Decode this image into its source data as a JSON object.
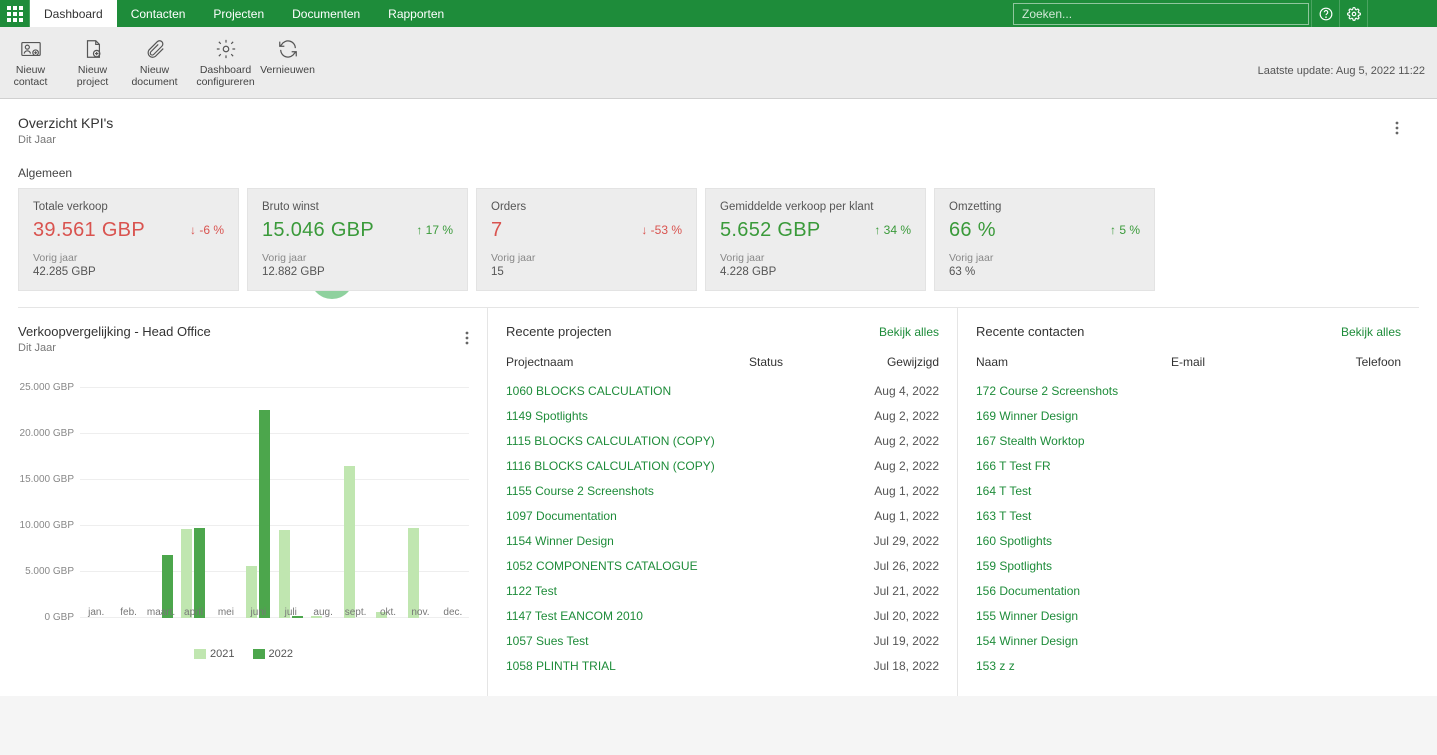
{
  "nav": {
    "items": [
      "Dashboard",
      "Contacten",
      "Projecten",
      "Documenten",
      "Rapporten"
    ],
    "active": 0,
    "search_placeholder": "Zoeken..."
  },
  "toolbar": {
    "items": [
      {
        "label": "Nieuw contact"
      },
      {
        "label": "Nieuw project"
      },
      {
        "label": "Nieuw document"
      },
      {
        "label": "Dashboard configureren"
      },
      {
        "label": "Vernieuwen"
      }
    ],
    "last_update_label": "Laatste update:",
    "last_update_value": "Aug 5, 2022 11:22"
  },
  "kpi_section": {
    "title": "Overzicht KPI's",
    "subtitle": "Dit Jaar",
    "group_label": "Algemeen",
    "prev_label": "Vorig jaar",
    "cards": [
      {
        "label": "Totale verkoop",
        "value": "39.561 GBP",
        "delta": "-6 %",
        "dir": "down",
        "prev": "42.285 GBP"
      },
      {
        "label": "Bruto winst",
        "value": "15.046 GBP",
        "delta": "17 %",
        "dir": "up",
        "prev": "12.882 GBP"
      },
      {
        "label": "Orders",
        "value": "7",
        "delta": "-53 %",
        "dir": "down",
        "prev": "15"
      },
      {
        "label": "Gemiddelde verkoop per klant",
        "value": "5.652 GBP",
        "delta": "34 %",
        "dir": "up",
        "prev": "4.228 GBP"
      },
      {
        "label": "Omzetting",
        "value": "66 %",
        "delta": "5 %",
        "dir": "up",
        "prev": "63 %"
      }
    ]
  },
  "chart_panel": {
    "title": "Verkoopvergelijking  -  Head Office",
    "subtitle": "Dit Jaar"
  },
  "chart_data": {
    "type": "bar",
    "title": "Verkoopvergelijking - Head Office",
    "xlabel": "",
    "ylabel": "",
    "ylim": [
      0,
      25000
    ],
    "yticks": [
      0,
      5000,
      10000,
      15000,
      20000,
      25000
    ],
    "ytick_labels": [
      "0 GBP",
      "5.000 GBP",
      "10.000 GBP",
      "15.000 GBP",
      "20.000 GBP",
      "25.000 GBP"
    ],
    "categories": [
      "jan.",
      "feb.",
      "maart.",
      "april",
      "mei",
      "juni",
      "juli",
      "aug.",
      "sept.",
      "okt.",
      "nov.",
      "dec."
    ],
    "series": [
      {
        "name": "2021",
        "values": [
          0,
          0,
          0,
          9700,
          0,
          5700,
          9600,
          200,
          16500,
          600,
          9800,
          0
        ]
      },
      {
        "name": "2022",
        "values": [
          0,
          0,
          6900,
          9800,
          0,
          22600,
          250,
          0,
          0,
          0,
          0,
          0
        ]
      }
    ],
    "legend": [
      "2021",
      "2022"
    ]
  },
  "projects": {
    "title": "Recente projecten",
    "view_all": "Bekijk alles",
    "headers": {
      "name": "Projectnaam",
      "status": "Status",
      "date": "Gewijzigd"
    },
    "rows": [
      {
        "name": "1060 BLOCKS CALCULATION",
        "status": "",
        "date": "Aug 4, 2022"
      },
      {
        "name": "1149 Spotlights",
        "status": "",
        "date": "Aug 2, 2022"
      },
      {
        "name": "1115 BLOCKS CALCULATION (COPY)",
        "status": "",
        "date": "Aug 2, 2022"
      },
      {
        "name": "1116 BLOCKS CALCULATION (COPY)",
        "status": "",
        "date": "Aug 2, 2022"
      },
      {
        "name": "1155 Course 2 Screenshots",
        "status": "",
        "date": "Aug 1, 2022"
      },
      {
        "name": "1097 Documentation",
        "status": "",
        "date": "Aug 1, 2022"
      },
      {
        "name": "1154 Winner Design",
        "status": "",
        "date": "Jul 29, 2022"
      },
      {
        "name": "1052 COMPONENTS CATALOGUE",
        "status": "",
        "date": "Jul 26, 2022"
      },
      {
        "name": "1122 Test",
        "status": "",
        "date": "Jul 21, 2022"
      },
      {
        "name": "1147 Test EANCOM 2010",
        "status": "",
        "date": "Jul 20, 2022"
      },
      {
        "name": "1057 Sues Test",
        "status": "",
        "date": "Jul 19, 2022"
      },
      {
        "name": "1058 PLINTH TRIAL",
        "status": "",
        "date": "Jul 18, 2022"
      }
    ]
  },
  "contacts": {
    "title": "Recente contacten",
    "view_all": "Bekijk alles",
    "headers": {
      "name": "Naam",
      "email": "E-mail",
      "phone": "Telefoon"
    },
    "rows": [
      {
        "name": "172 Course 2 Screenshots",
        "email": "",
        "phone": ""
      },
      {
        "name": "169 Winner Design",
        "email": "",
        "phone": ""
      },
      {
        "name": "167 Stealth Worktop",
        "email": "",
        "phone": ""
      },
      {
        "name": "166 T Test FR",
        "email": "",
        "phone": ""
      },
      {
        "name": "164 T Test",
        "email": "",
        "phone": ""
      },
      {
        "name": "163 T Test",
        "email": "",
        "phone": ""
      },
      {
        "name": "160 Spotlights",
        "email": "",
        "phone": ""
      },
      {
        "name": "159 Spotlights",
        "email": "",
        "phone": ""
      },
      {
        "name": "156 Documentation",
        "email": "",
        "phone": ""
      },
      {
        "name": "155 Winner Design",
        "email": "",
        "phone": ""
      },
      {
        "name": "154 Winner Design",
        "email": "",
        "phone": ""
      },
      {
        "name": "153 z z",
        "email": "",
        "phone": ""
      }
    ]
  }
}
